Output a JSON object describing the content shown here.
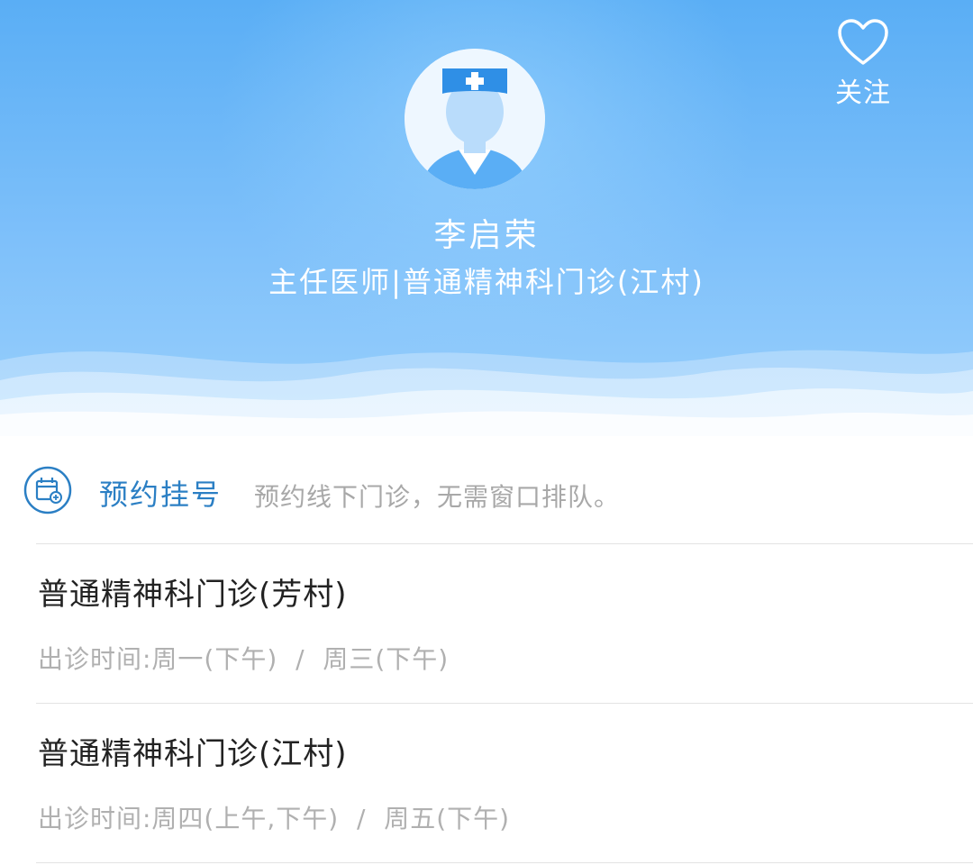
{
  "header": {
    "doctor_name": "李启荣",
    "doctor_title": "主任医师|普通精神科门诊(江村)",
    "follow_label": "关注",
    "follow_icon": "heart-outline-icon",
    "avatar_icon": "doctor-avatar-icon",
    "colors": {
      "gradient_top": "#5aaef5",
      "gradient_bottom": "#9ad0fc"
    }
  },
  "booking": {
    "icon": "calendar-add-icon",
    "title": "预约挂号",
    "description": "预约线下门诊，无需窗口排队。",
    "accent": "#2b7fc4"
  },
  "clinics": [
    {
      "name": "普通精神科门诊(芳村)",
      "schedule": "出诊时间:周一(下午)  /  周三(下午)"
    },
    {
      "name": "普通精神科门诊(江村)",
      "schedule": "出诊时间:周四(上午,下午)  /  周五(下午)"
    }
  ]
}
